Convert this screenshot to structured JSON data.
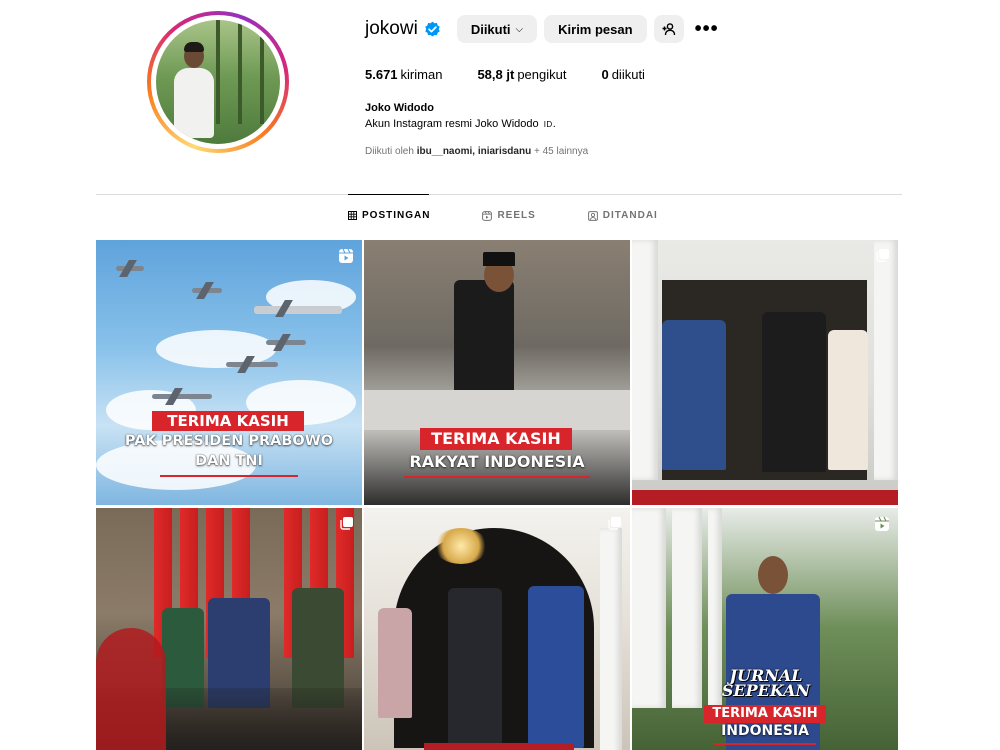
{
  "profile": {
    "username": "jokowi",
    "buttons": {
      "following": "Diikuti",
      "message": "Kirim pesan"
    },
    "stats": [
      {
        "value": "5.671",
        "label": "kiriman"
      },
      {
        "value": "58,8 jt",
        "label": "pengikut"
      },
      {
        "value": "0",
        "label": "diikuti"
      }
    ],
    "full_name": "Joko Widodo",
    "bio": "Akun Instagram resmi Joko Widodo",
    "bio_flag": "ID",
    "followed_by_prefix": "Diikuti oleh",
    "followed_by_users": "ibu__naomi, iniarisdanu",
    "followed_by_suffix": "+ 45 lainnya"
  },
  "tabs": [
    {
      "label": "POSTINGAN",
      "icon": "grid-icon",
      "active": true
    },
    {
      "label": "REELS",
      "icon": "reels-icon",
      "active": false
    },
    {
      "label": "DITANDAI",
      "icon": "tagged-icon",
      "active": false
    }
  ],
  "posts": [
    {
      "type": "reel",
      "banner": "TERIMA KASIH",
      "line1": "PAK PRESIDEN PRABOWO",
      "line2": "DAN TNI"
    },
    {
      "type": "image",
      "banner": "TERIMA KASIH",
      "line1": "RAKYAT INDONESIA"
    },
    {
      "type": "carousel"
    },
    {
      "type": "carousel"
    },
    {
      "type": "carousel"
    },
    {
      "type": "reel",
      "jurnal1": "JURNAL",
      "jurnal2": "SEPEKAN",
      "banner": "TERIMA KASIH",
      "line1": "INDONESIA"
    }
  ],
  "colors": {
    "verified": "#0095f6",
    "banner_red": "#d8252b",
    "muted": "#737373"
  }
}
